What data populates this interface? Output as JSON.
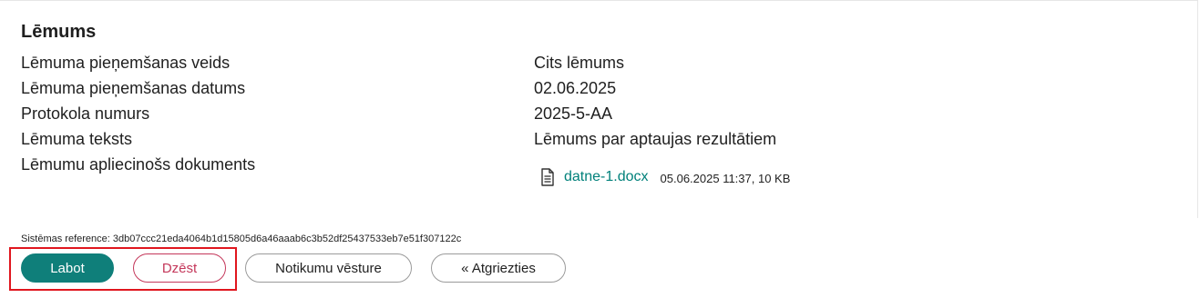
{
  "decision": {
    "title": "Lēmums",
    "fields": [
      {
        "label": "Lēmuma pieņemšanas veids",
        "value": "Cits lēmums"
      },
      {
        "label": "Lēmuma pieņemšanas datums",
        "value": "02.06.2025"
      },
      {
        "label": "Protokola numurs",
        "value": "2025-5-AA"
      },
      {
        "label": "Lēmuma teksts",
        "value": "Lēmums par aptaujas rezultātiem"
      },
      {
        "label": "Lēmumu apliecinošs dokuments",
        "value": ""
      }
    ],
    "document": {
      "icon": "document-icon",
      "file_name": "datne-1.docx",
      "meta": "05.06.2025 11:37, 10 KB"
    }
  },
  "system_reference": "Sistēmas reference: 3db07ccc21eda4064b1d15805d6a46aaab6c3b52df25437533eb7e51f307122c",
  "actions": {
    "edit_label": "Labot",
    "delete_label": "Dzēst",
    "history_label": "Notikumu vēsture",
    "back_label": "« Atgriezties"
  },
  "colors": {
    "accent": "#0f7f7a",
    "link": "#00807a",
    "danger": "#c4375a",
    "highlight": "#e0161e"
  }
}
